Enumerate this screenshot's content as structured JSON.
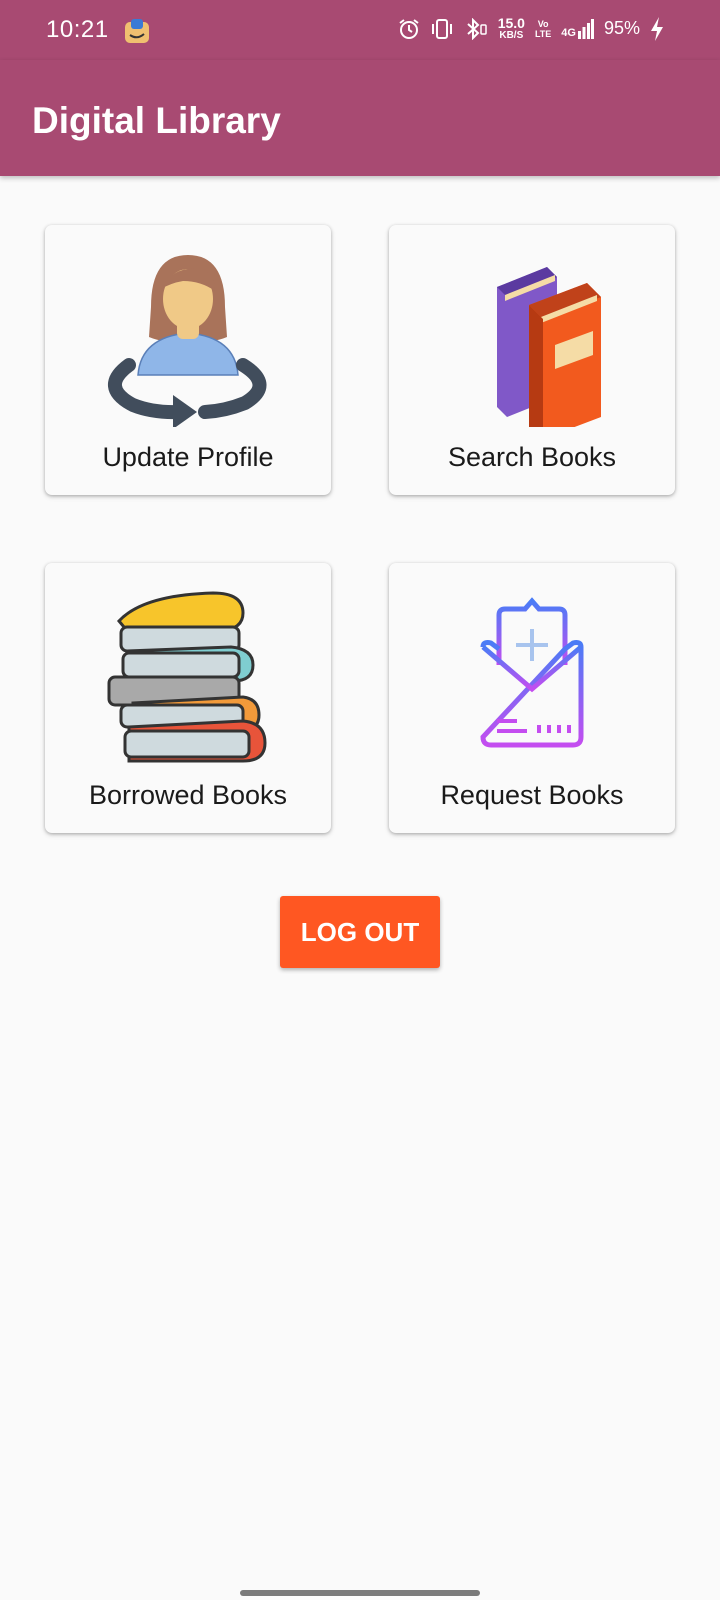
{
  "status_bar": {
    "time": "10:21",
    "net_speed_value": "15.0",
    "net_speed_unit": "KB/S",
    "volte_top": "Vo",
    "volte_bottom": "LTE",
    "network": "4G",
    "battery": "95%",
    "icons": [
      "notification-app-icon",
      "alarm-icon",
      "vibrate-icon",
      "bluetooth-icon",
      "signal-icon",
      "charging-icon"
    ]
  },
  "app_bar": {
    "title": "Digital Library",
    "color": "#a84a72"
  },
  "cards": {
    "update_profile": {
      "label": "Update Profile",
      "icon": "profile-update-icon"
    },
    "search_books": {
      "label": "Search Books",
      "icon": "books-icon"
    },
    "borrowed_books": {
      "label": "Borrowed Books",
      "icon": "book-stack-icon"
    },
    "request_books": {
      "label": "Request Books",
      "icon": "mail-request-icon"
    }
  },
  "logout": {
    "label": "LOG OUT",
    "color": "#ff5722"
  }
}
